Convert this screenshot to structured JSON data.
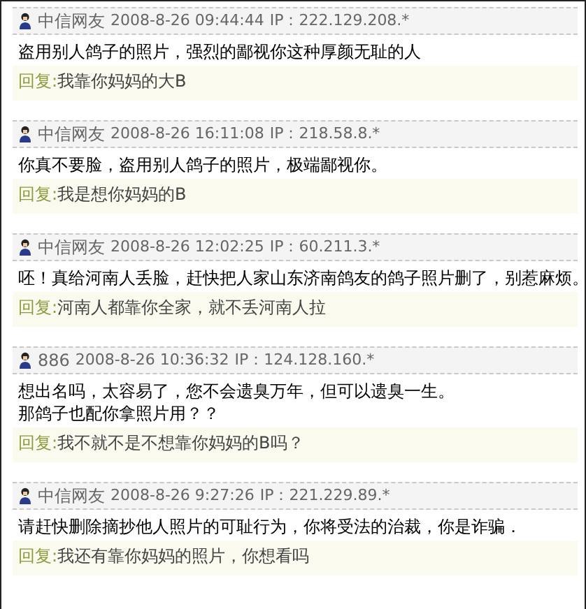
{
  "posts": [
    {
      "author": "中信网友",
      "time": "2008-8-26 09:44:44",
      "ip": "IP：222.129.208.*",
      "lines": [
        "盗用别人鸽子的照片，强烈的鄙视你这种厚颜无耻的人"
      ],
      "reply_label": "回复:",
      "reply": "我靠你妈妈的大B"
    },
    {
      "author": "中信网友",
      "time": "2008-8-26 16:11:08",
      "ip": "IP：218.58.8.*",
      "lines": [
        "你真不要脸，盗用别人鸽子的照片，极端鄙视你。"
      ],
      "reply_label": "回复:",
      "reply": "我是想你妈妈的B"
    },
    {
      "author": "中信网友",
      "time": "2008-8-26 12:02:25",
      "ip": "IP：60.211.3.*",
      "lines": [
        "呸！真给河南人丢脸，赶快把人家山东济南鸽友的鸽子照片删了，别惹麻烦。"
      ],
      "reply_label": "回复:",
      "reply": "河南人都靠你全家，就不丢河南人拉"
    },
    {
      "author": "886",
      "time": "2008-8-26 10:36:32",
      "ip": "IP：124.128.160.*",
      "lines": [
        "想出名吗，太容易了，您不会遗臭万年，但可以遗臭一生。",
        "那鸽子也配你拿照片用？？"
      ],
      "reply_label": "回复:",
      "reply": "我不就不是不想靠你妈妈的B吗？"
    },
    {
      "author": "中信网友",
      "time": "2008-8-26 9:27:26",
      "ip": "IP：221.229.89.*",
      "lines": [
        "请赶快删除摘抄他人照片的可耻行为，你将受法的治裁，你是诈骗．"
      ],
      "reply_label": "回复:",
      "reply": "我还有靠你妈妈的照片，你想看吗"
    }
  ]
}
